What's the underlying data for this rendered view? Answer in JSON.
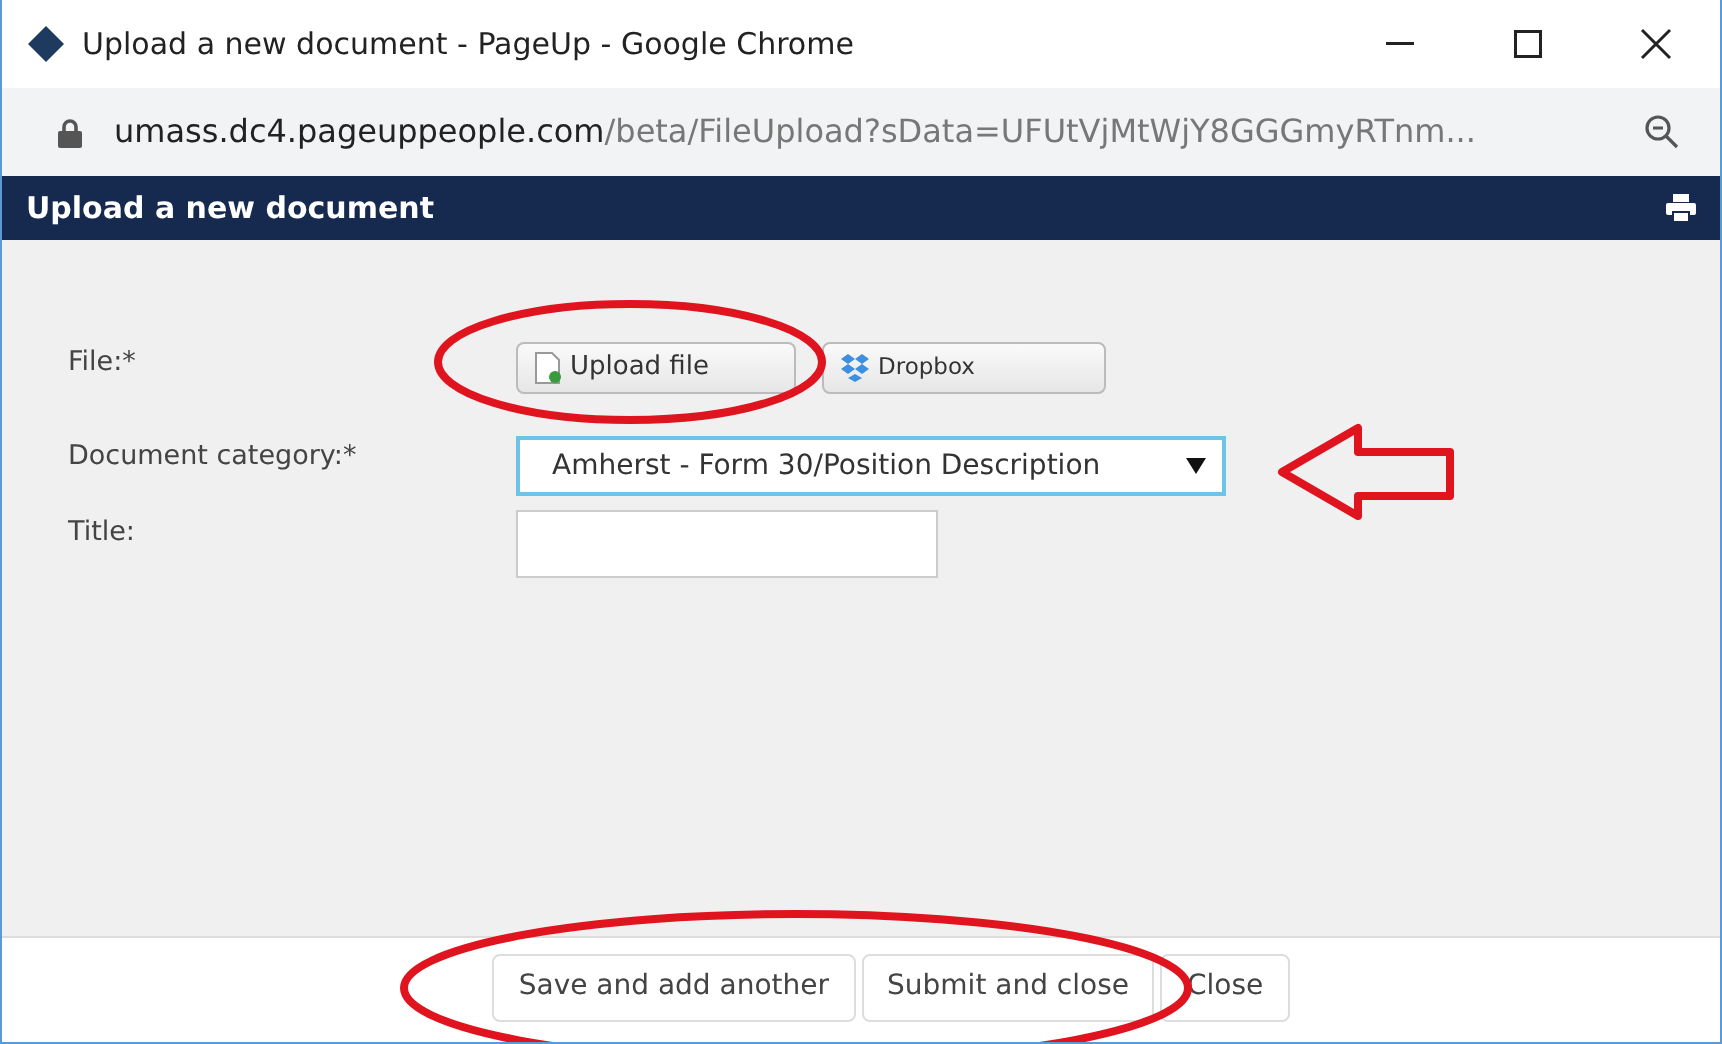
{
  "window": {
    "title": "Upload a new document - PageUp - Google Chrome"
  },
  "address_bar": {
    "domain": "umass.dc4.pageuppeople.com",
    "path": "/beta/FileUpload?sData=UFUtVjMtWjY8GGGmyRTnm..."
  },
  "header": {
    "title": "Upload a new document"
  },
  "form": {
    "file_label": "File:*",
    "upload_button": "Upload file",
    "dropbox_button": "Dropbox",
    "category_label": "Document category:*",
    "category_value": "Amherst - Form 30/Position Description",
    "title_label": "Title:"
  },
  "footer": {
    "buttons": [
      "Save and add another",
      "Submit and close",
      "Close"
    ]
  }
}
